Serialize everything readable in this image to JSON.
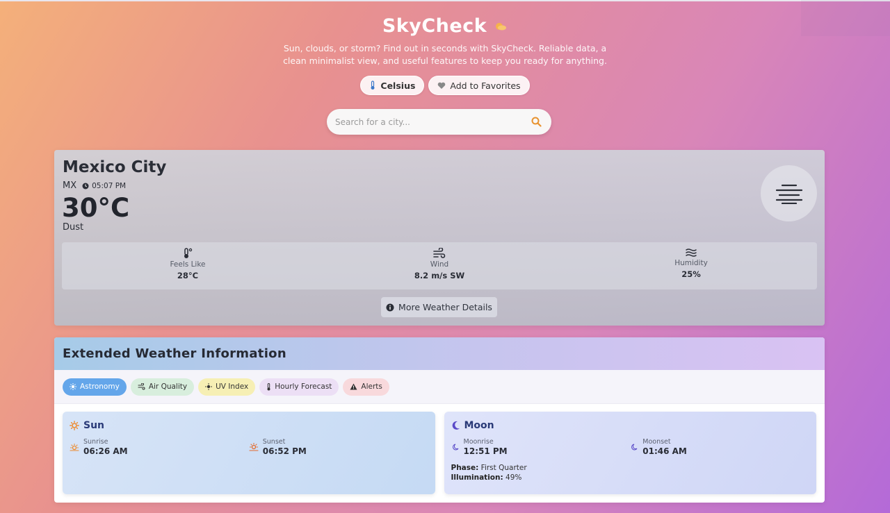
{
  "header": {
    "title": "SkyCheck",
    "tagline": "Sun, clouds, or storm? Find out in seconds with SkyCheck. Reliable data, a clean minimalist view, and useful features to keep you ready for anything.",
    "unit_button": "Celsius",
    "favorites_button": "Add to Favorites"
  },
  "search": {
    "placeholder": "Search for a city..."
  },
  "current": {
    "city": "Mexico City",
    "country": "MX",
    "time": "05:07 PM",
    "temperature": "30°C",
    "condition": "Dust",
    "condition_icon": "haze-icon",
    "stats": [
      {
        "label": "Feels Like",
        "value": "28°C",
        "icon": "thermometer-icon"
      },
      {
        "label": "Wind",
        "value": "8.2 m/s SW",
        "icon": "wind-icon"
      },
      {
        "label": "Humidity",
        "value": "25%",
        "icon": "water-icon"
      }
    ],
    "more_button": "More Weather Details"
  },
  "extended": {
    "title": "Extended Weather Information",
    "tabs": [
      {
        "label": "Astronomy",
        "active": true
      },
      {
        "label": "Air Quality"
      },
      {
        "label": "UV Index"
      },
      {
        "label": "Hourly Forecast"
      },
      {
        "label": "Alerts"
      }
    ],
    "sun": {
      "title": "Sun",
      "sunrise_label": "Sunrise",
      "sunrise": "06:26 AM",
      "sunset_label": "Sunset",
      "sunset": "06:52 PM"
    },
    "moon": {
      "title": "Moon",
      "moonrise_label": "Moonrise",
      "moonrise": "12:51 PM",
      "moonset_label": "Moonset",
      "moonset": "01:46 AM",
      "phase_label": "Phase:",
      "phase": "First Quarter",
      "illumination_label": "Illumination:",
      "illumination": "49%"
    }
  },
  "colors": {
    "accent_blue": "#64a6ea",
    "sun_orange": "#ee8a2c",
    "moon_purple": "#5a4ac8"
  }
}
